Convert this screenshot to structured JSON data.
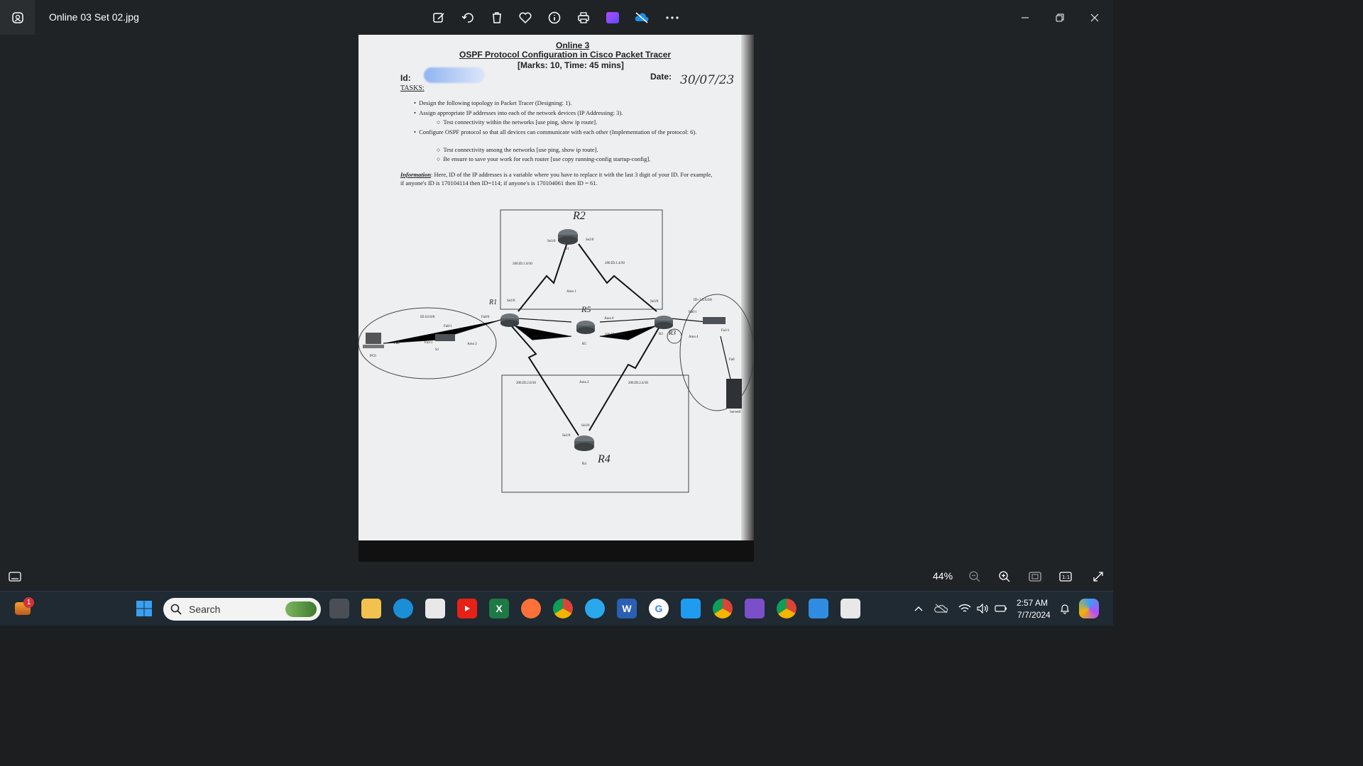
{
  "window": {
    "title": "Online 03 Set 02.jpg",
    "toolbar": [
      "edit-icon",
      "rotate-icon",
      "delete-icon",
      "favorite-icon",
      "info-icon",
      "print-icon",
      "clipchamp-icon",
      "onedrive-icon",
      "more-icon"
    ],
    "controls": [
      "minimize-icon",
      "restore-icon",
      "close-icon"
    ]
  },
  "document": {
    "heading": "Online 3",
    "title": "OSPF Protocol Configuration in Cisco Packet Tracer",
    "marks": "[Marks: 10, Time: 45 mins]",
    "id_label": "Id:",
    "date_label": "Date:",
    "date_value": "30/07/23",
    "tasks_label": "TASKS:",
    "task1": "Design the following topology in Packet Tracer (Designing: 1).",
    "task2": "Assign appropriate IP addresses into each of the network devices (IP Addressing: 3).",
    "task2a": "Test connectivity within the networks [use ping, show ip route].",
    "task3": "Configure OSPF protocol so that all devices can communicate with each other (Implementation of the protocol: 6).",
    "task3a": "Test connectivity among the networks [use ping, show ip route].",
    "task3b": "Be ensure to save your work for each router [use copy running-config startup-config].",
    "info_label": "Information",
    "info_text": ": Here, ID of the IP addresses is a variable where you have to replace it with the last 3 digit of your ID. For example, if anyone's ID is 170104114 then ID=114; if anyone's is 170104061 then ID = 61.",
    "diagram": {
      "r2_hand": "R2",
      "r1_label": "R1",
      "r5_hand": "R5",
      "r5_label": "R5",
      "r3_label": "R3",
      "r3_hand": "R3",
      "r4_label": "R4",
      "r4_hand": "R4",
      "r1_hand": "R1",
      "net_top_left": "200.ID.1.0/30",
      "net_top_right": "200.ID.1.4/30",
      "net_mid_left": "200.ID.0.0/30",
      "net_mid_right": "200.ID.0.4/30",
      "net_bot_left": "200.ID.2.0/30",
      "net_bot_right": "200.ID.2.4/30",
      "lan_left": "ID.0.0.0/8",
      "lan_right": "ID+1.0.0.0/8",
      "area1": "Area 1",
      "area0": "Area 0",
      "area2": "Area 2",
      "area3": "Area 3",
      "area4": "Area 4",
      "pc0": "PC0",
      "s1": "S1",
      "server0": "Server0",
      "se30": "Se3/0",
      "se20": "Se2/0",
      "fa00": "Fa0/0",
      "fa01": "Fa0/1",
      "fa11": "Fa1/1",
      "fa0": "Fa0"
    }
  },
  "bottombar": {
    "zoom": "44%"
  },
  "taskbar": {
    "search_placeholder": "Search",
    "notification_count": "1",
    "time": "2:57 AM",
    "date": "7/7/2024"
  }
}
